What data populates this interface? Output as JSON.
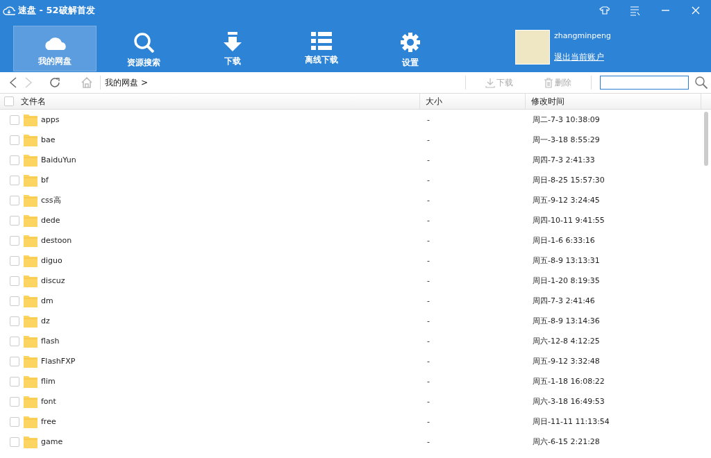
{
  "window": {
    "title": "速盘 - 52破解首发"
  },
  "nav_tabs": [
    {
      "label": "我的网盘",
      "selected": true
    },
    {
      "label": "资源搜索",
      "selected": false
    },
    {
      "label": "下载",
      "selected": false
    },
    {
      "label": "离线下载",
      "selected": false
    },
    {
      "label": "设置",
      "selected": false
    }
  ],
  "account": {
    "username": "zhangminpeng",
    "logout_link": "退出当前账户"
  },
  "toolbar": {
    "back_disabled": false,
    "forward_disabled": true,
    "breadcrumb": "我的网盘",
    "breadcrumb_sep": ">",
    "actions": [
      {
        "label": "下载",
        "disabled": true
      },
      {
        "label": "删除",
        "disabled": true
      }
    ]
  },
  "table": {
    "columns": [
      "文件名",
      "大小",
      "修改时间"
    ],
    "select_all_checked": false,
    "rows": [
      {
        "name": "apps",
        "size": "-",
        "modified": "周二-7-3 10:38:09",
        "checked": false
      },
      {
        "name": "bae",
        "size": "-",
        "modified": "周一-3-18 8:55:29",
        "checked": false
      },
      {
        "name": "BaiduYun",
        "size": "-",
        "modified": "周四-7-3 2:41:33",
        "checked": false
      },
      {
        "name": "bf",
        "size": "-",
        "modified": "周日-8-25 15:57:30",
        "checked": false
      },
      {
        "name": "css高",
        "size": "-",
        "modified": "周五-9-12 3:24:45",
        "checked": false
      },
      {
        "name": "dede",
        "size": "-",
        "modified": "周四-10-11 9:41:55",
        "checked": false
      },
      {
        "name": "destoon",
        "size": "-",
        "modified": "周日-1-6 6:33:16",
        "checked": false
      },
      {
        "name": "diguo",
        "size": "-",
        "modified": "周五-8-9 13:13:31",
        "checked": false
      },
      {
        "name": "discuz",
        "size": "-",
        "modified": "周日-1-20 8:19:35",
        "checked": false
      },
      {
        "name": "dm",
        "size": "-",
        "modified": "周四-7-3 2:41:46",
        "checked": false
      },
      {
        "name": "dz",
        "size": "-",
        "modified": "周五-8-9 13:14:36",
        "checked": false
      },
      {
        "name": "flash",
        "size": "-",
        "modified": "周六-12-8 4:12:25",
        "checked": false
      },
      {
        "name": "FlashFXP",
        "size": "-",
        "modified": "周五-9-12 3:32:48",
        "checked": false
      },
      {
        "name": "flim",
        "size": "-",
        "modified": "周五-1-18 16:08:22",
        "checked": false
      },
      {
        "name": "font",
        "size": "-",
        "modified": "周六-3-18 16:49:53",
        "checked": false
      },
      {
        "name": "free",
        "size": "-",
        "modified": "周日-11-11 11:13:54",
        "checked": false
      },
      {
        "name": "game",
        "size": "-",
        "modified": "周六-6-15 2:21:28",
        "checked": false
      }
    ]
  }
}
